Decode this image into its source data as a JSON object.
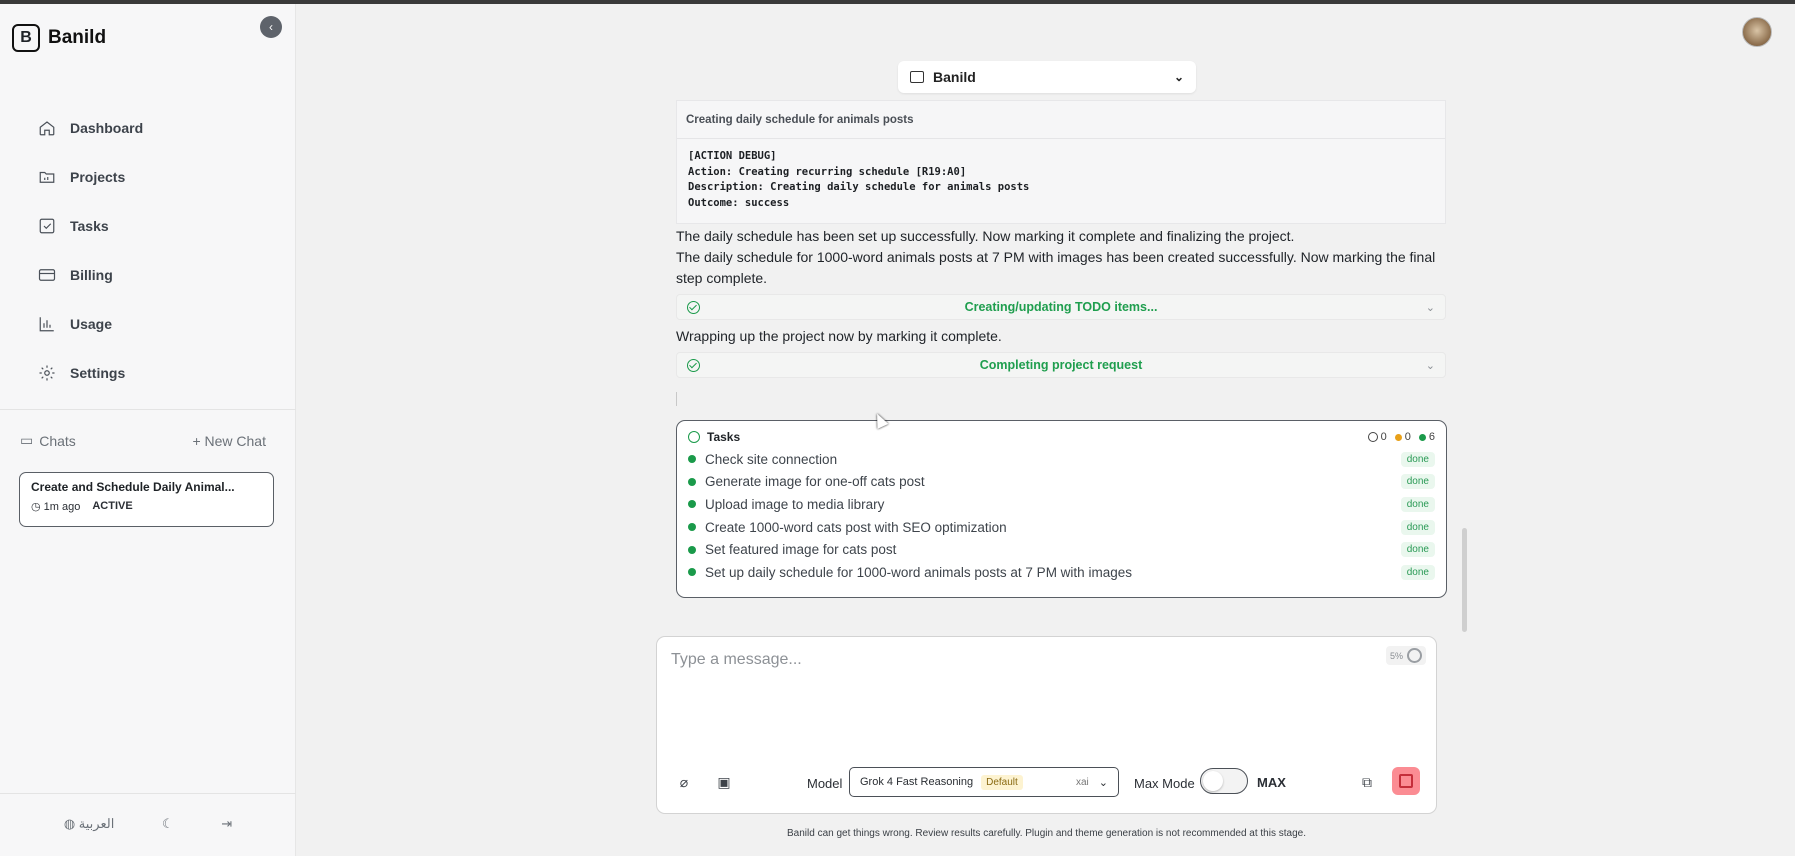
{
  "app": {
    "name": "Banild"
  },
  "sidebar": {
    "nav": [
      {
        "label": "Dashboard",
        "icon": "home-icon"
      },
      {
        "label": "Projects",
        "icon": "folder-icon"
      },
      {
        "label": "Tasks",
        "icon": "checkbox-icon"
      },
      {
        "label": "Billing",
        "icon": "card-icon"
      },
      {
        "label": "Usage",
        "icon": "bar-chart-icon"
      },
      {
        "label": "Settings",
        "icon": "gear-icon"
      }
    ],
    "chats_label": "Chats",
    "new_chat_label": "+ New Chat",
    "chat": {
      "title": "Create and Schedule Daily Animal...",
      "time": "1m ago",
      "status": "ACTIVE"
    },
    "language_label": "العربية"
  },
  "project_selector": {
    "value": "Banild"
  },
  "messages": {
    "debug_title": "Creating daily schedule for animals posts",
    "debug_lines": "[ACTION DEBUG]\nAction: Creating recurring schedule [R19:A0]\nDescription: Creating daily schedule for animals posts\nOutcome: success",
    "para1": "The daily schedule has been set up successfully. Now marking it complete and finalizing the project.",
    "para2": "The daily schedule for 1000-word animals posts at 7 PM with images has been created successfully. Now marking the final step complete.",
    "tool1": "Creating/updating TODO items...",
    "para3": "Wrapping up the project now by marking it complete.",
    "tool2": "Completing project request"
  },
  "tasks": {
    "title": "Tasks",
    "counts": {
      "pending": "0",
      "in_progress": "0",
      "done": "6"
    },
    "items": [
      {
        "label": "Check site connection",
        "status": "done"
      },
      {
        "label": "Generate image for one-off cats post",
        "status": "done"
      },
      {
        "label": "Upload image to media library",
        "status": "done"
      },
      {
        "label": "Create 1000-word cats post with SEO optimization",
        "status": "done"
      },
      {
        "label": "Set featured image for cats post",
        "status": "done"
      },
      {
        "label": "Set up daily schedule for 1000-word animals posts at 7 PM with images",
        "status": "done"
      }
    ]
  },
  "composer": {
    "placeholder": "Type a message...",
    "context_usage": "5%",
    "model_label": "Model",
    "model_name": "Grok 4 Fast Reasoning",
    "model_badge": "Default",
    "model_provider": "xai",
    "max_mode_label": "Max Mode",
    "max_label": "MAX",
    "max_mode_on": false
  },
  "disclaimer": "Banild can get things wrong. Review results carefully. Plugin and theme generation is not recommended at this stage.",
  "colors": {
    "success": "#1f9e4e",
    "stop": "#fb8c93",
    "pending": "#e8a019"
  }
}
